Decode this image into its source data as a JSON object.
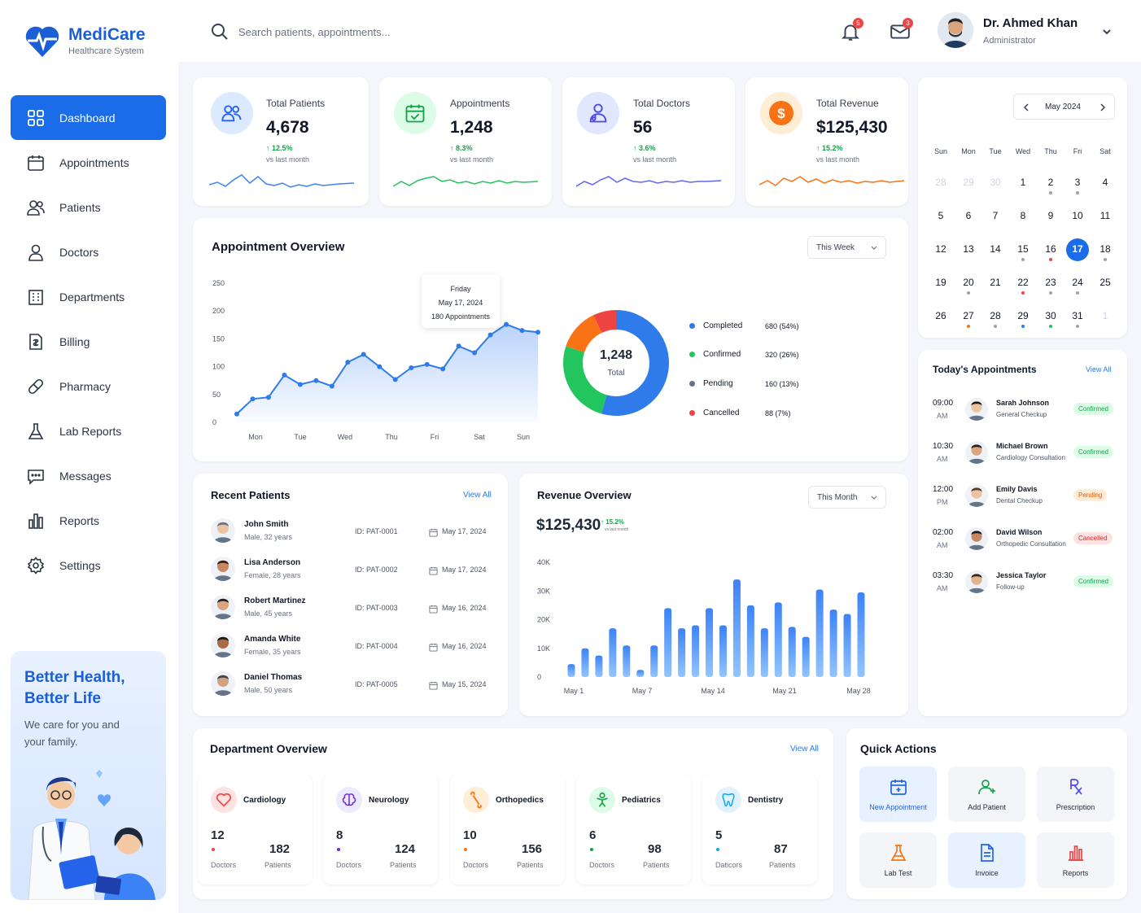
{
  "app": {
    "name": "MediCare",
    "subtitle": "Healthcare System"
  },
  "sidebar": {
    "items": [
      {
        "label": "Dashboard",
        "icon": "grid-icon"
      },
      {
        "label": "Appointments",
        "icon": "calendar-icon"
      },
      {
        "label": "Patients",
        "icon": "users-icon"
      },
      {
        "label": "Doctors",
        "icon": "user-icon"
      },
      {
        "label": "Departments",
        "icon": "building-icon"
      },
      {
        "label": "Billing",
        "icon": "invoice-icon"
      },
      {
        "label": "Pharmacy",
        "icon": "pill-icon"
      },
      {
        "label": "Lab Reports",
        "icon": "flask-icon"
      },
      {
        "label": "Messages",
        "icon": "message-icon"
      },
      {
        "label": "Reports",
        "icon": "bar-chart-icon"
      },
      {
        "label": "Settings",
        "icon": "gear-icon"
      }
    ],
    "promo": {
      "title": "Better Health, Better Life",
      "text": "We care for you and your family."
    }
  },
  "header": {
    "search_placeholder": "Search patients, appointments...",
    "notifications_count": "5",
    "messages_count": "3",
    "user_name": "Dr. Ahmed Khan",
    "user_role": "Administrator"
  },
  "stats": [
    {
      "label": "Total Patients",
      "value": "4,678",
      "change": "↑ 12.5%",
      "sub": "vs last month",
      "color": "#3b82f6"
    },
    {
      "label": "Appointments",
      "value": "1,248",
      "change": "↑ 8.3%",
      "sub": "vs last month",
      "color": "#22c55e"
    },
    {
      "label": "Total Doctors",
      "value": "56",
      "change": "↑ 3.6%",
      "sub": "vs last month",
      "color": "#6366f1"
    },
    {
      "label": "Total Revenue",
      "value": "$125,430",
      "change": "↑ 15.2%",
      "sub": "vs last month",
      "color": "#f97316"
    }
  ],
  "appointment_overview": {
    "title": "Appointment Overview",
    "period": "This Week",
    "tooltip": {
      "day": "Friday",
      "date": "May 17, 2024",
      "count": "180 Appointments"
    },
    "donut_total": "1,248",
    "donut_label": "Total",
    "legend": [
      {
        "label": "Completed",
        "value": "680 (54%)",
        "color": "#2f7bea"
      },
      {
        "label": "Confirmed",
        "value": "320 (26%)",
        "color": "#22c55e"
      },
      {
        "label": "Pending",
        "value": "160 (13%)",
        "color": "#6b7280"
      },
      {
        "label": "Cancelled",
        "value": "88 (7%)",
        "color": "#ef4444"
      }
    ]
  },
  "recent_patients": {
    "title": "Recent Patients",
    "view_all": "View All",
    "rows": [
      {
        "name": "John Smith",
        "info": "Male, 32 years",
        "id": "ID: PAT-0001",
        "date": "May 17, 2024"
      },
      {
        "name": "Lisa Anderson",
        "info": "Female, 28 years",
        "id": "ID: PAT-0002",
        "date": "May 17, 2024"
      },
      {
        "name": "Robert Martinez",
        "info": "Male, 45 years",
        "id": "ID: PAT-0003",
        "date": "May 16, 2024"
      },
      {
        "name": "Amanda White",
        "info": "Female, 35 years",
        "id": "ID: PAT-0004",
        "date": "May 16, 2024"
      },
      {
        "name": "Daniel Thomas",
        "info": "Male, 50 years",
        "id": "ID: PAT-0005",
        "date": "May 15, 2024"
      }
    ]
  },
  "revenue_overview": {
    "title": "Revenue Overview",
    "period": "This Month",
    "amount": "$125,430",
    "change": "↑ 15.2%",
    "change_sub": "vs last month"
  },
  "calendar": {
    "month": "May 2024",
    "weekdays": [
      "Sun",
      "Mon",
      "Tue",
      "Wed",
      "Thu",
      "Fri",
      "Sat"
    ],
    "selected": "17"
  },
  "todays_appointments": {
    "title": "Today's Appointments",
    "view_all": "View All",
    "rows": [
      {
        "time": "09:00",
        "ampm": "AM",
        "name": "Sarah Johnson",
        "type": "General Checkup",
        "status": "Confirmed"
      },
      {
        "time": "10:30",
        "ampm": "AM",
        "name": "Michael Brown",
        "type": "Cardiology Consultation",
        "status": "Confirmed"
      },
      {
        "time": "12:00",
        "ampm": "PM",
        "name": "Emily Davis",
        "type": "Dental Checkup",
        "status": "Pending"
      },
      {
        "time": "02:00",
        "ampm": "AM",
        "name": "David Wilson",
        "type": "Orthopedic Consultation",
        "status": "Cancelled"
      },
      {
        "time": "03:30",
        "ampm": "AM",
        "name": "Jessica Taylor",
        "type": "Follow-up",
        "status": "Confirmed"
      }
    ]
  },
  "departments": {
    "title": "Department Overview",
    "view_all": "View All",
    "items": [
      {
        "name": "Cardiology",
        "doctors": "12",
        "patients": "182",
        "doctors_label": "Doctors",
        "patients_label": "Patients"
      },
      {
        "name": "Neurology",
        "doctors": "8",
        "patients": "124",
        "doctors_label": "Doctors",
        "patients_label": "Patients"
      },
      {
        "name": "Orthopedics",
        "doctors": "10",
        "patients": "156",
        "doctors_label": "Doctors",
        "patients_label": "Patients"
      },
      {
        "name": "Pediatrics",
        "doctors": "6",
        "patients": "98",
        "doctors_label": "Doctors",
        "patients_label": "Patients"
      },
      {
        "name": "Dentistry",
        "doctors": "5",
        "patients": "87",
        "doctors_label": "Daticors",
        "patients_label": "Patients"
      }
    ]
  },
  "quick_actions": {
    "title": "Quick Actions",
    "items": [
      "New Appointment",
      "Add Patient",
      "Prescription",
      "Lab Test",
      "Invoice",
      "Reports"
    ]
  },
  "chart_data": [
    {
      "type": "area",
      "categories": [
        "Mon",
        "Tue",
        "Wed",
        "Thu",
        "Fri",
        "Sat",
        "Sun"
      ],
      "x_ticks": [
        "Mon",
        "Tue",
        "Wed",
        "Thu",
        "Fri",
        "Sat",
        "Sun"
      ],
      "y_ticks": [
        "250",
        "200",
        "150",
        "100",
        "50",
        "0"
      ],
      "ylim": [
        0,
        250
      ],
      "values": [
        15,
        42,
        45,
        85,
        68,
        75,
        65,
        108,
        122,
        100,
        77,
        98,
        104,
        96,
        137,
        125,
        157,
        176,
        165,
        162
      ],
      "grid": false
    },
    {
      "type": "pie",
      "labels": [
        "Completed",
        "Confirmed",
        "Pending",
        "Cancelled"
      ],
      "values": [
        680,
        320,
        160,
        88
      ]
    },
    {
      "type": "bar",
      "x_ticks": [
        "May 1",
        "May 7",
        "May 14",
        "May 21",
        "May 28"
      ],
      "y_ticks": [
        "40K",
        "30K",
        "20K",
        "10K",
        "0"
      ],
      "ylim": [
        0,
        40000
      ],
      "values": [
        4500,
        10000,
        7500,
        17000,
        11000,
        2500,
        11000,
        24000,
        17000,
        18000,
        24000,
        18000,
        34000,
        25000,
        17000,
        26000,
        17500,
        14000,
        30500,
        23500,
        22000,
        29500
      ]
    }
  ]
}
